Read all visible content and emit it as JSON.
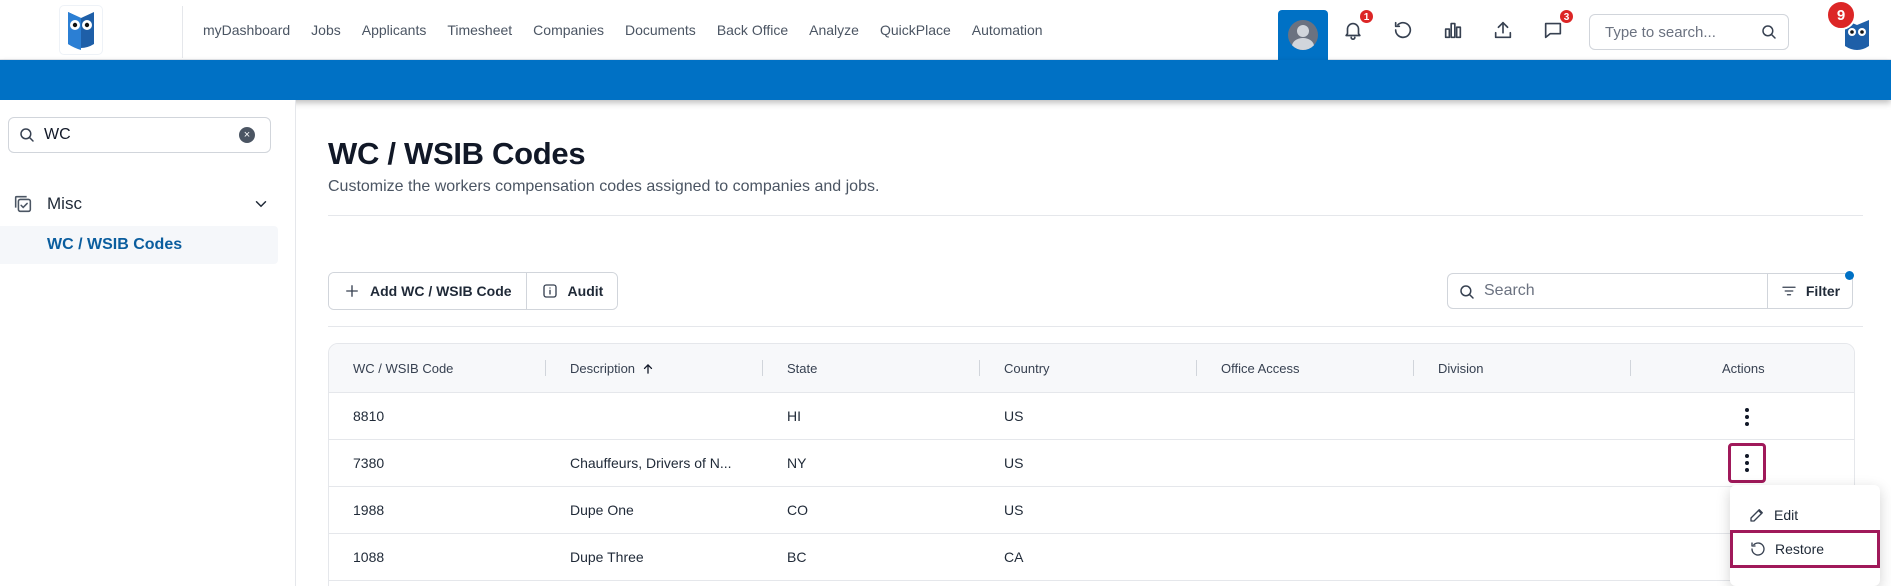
{
  "nav": {
    "items": [
      "myDashboard",
      "Jobs",
      "Applicants",
      "Timesheet",
      "Companies",
      "Documents",
      "Back Office",
      "Analyze",
      "QuickPlace",
      "Automation"
    ]
  },
  "topbar": {
    "notifications_badge": "1",
    "messages_badge": "3",
    "search_placeholder": "Type to search...",
    "owl_badge": "9"
  },
  "sidebar": {
    "search_value": "WC",
    "group_label": "Misc",
    "active_item": "WC / WSIB Codes"
  },
  "page": {
    "title": "WC / WSIB Codes",
    "subtitle": "Customize the workers compensation codes assigned to companies and jobs."
  },
  "toolbar": {
    "add_label": "Add WC / WSIB Code",
    "audit_label": "Audit",
    "search_placeholder": "Search",
    "filter_label": "Filter"
  },
  "table": {
    "headers": [
      "WC / WSIB Code",
      "Description",
      "State",
      "Country",
      "Office Access",
      "Division",
      "Actions"
    ],
    "rows": [
      {
        "code": "8810",
        "description": "",
        "state": "HI",
        "country": "US"
      },
      {
        "code": "7380",
        "description": "Chauffeurs, Drivers of N...",
        "state": "NY",
        "country": "US"
      },
      {
        "code": "1988",
        "description": "Dupe One",
        "state": "CO",
        "country": "US"
      },
      {
        "code": "1088",
        "description": "Dupe Three",
        "state": "BC",
        "country": "CA"
      }
    ]
  },
  "menu": {
    "edit_label": "Edit",
    "restore_label": "Restore"
  },
  "colors": {
    "brand_blue": "#0071c5",
    "highlight": "#a0195a",
    "badge_red": "#dc2626"
  }
}
